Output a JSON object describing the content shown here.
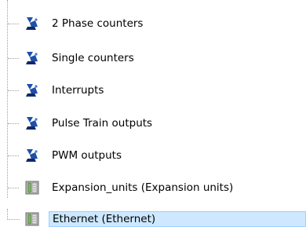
{
  "tree": {
    "items": [
      {
        "label": "2 Phase counters",
        "icon": "counter-icon"
      },
      {
        "label": "Single counters",
        "icon": "counter-icon"
      },
      {
        "label": "Interrupts",
        "icon": "counter-icon"
      },
      {
        "label": "Pulse Train outputs",
        "icon": "counter-icon"
      },
      {
        "label": "PWM outputs",
        "icon": "counter-icon"
      },
      {
        "label": "Expansion_units (Expansion units)",
        "icon": "module-icon"
      },
      {
        "label": "Ethernet (Ethernet)",
        "icon": "module-icon",
        "selected": true
      }
    ]
  },
  "colors": {
    "selection_background": "#cde8ff",
    "selection_border": "#99d1ff",
    "counter_icon_blue": "#1f4fa8",
    "module_icon_green": "#8fbf6f"
  }
}
